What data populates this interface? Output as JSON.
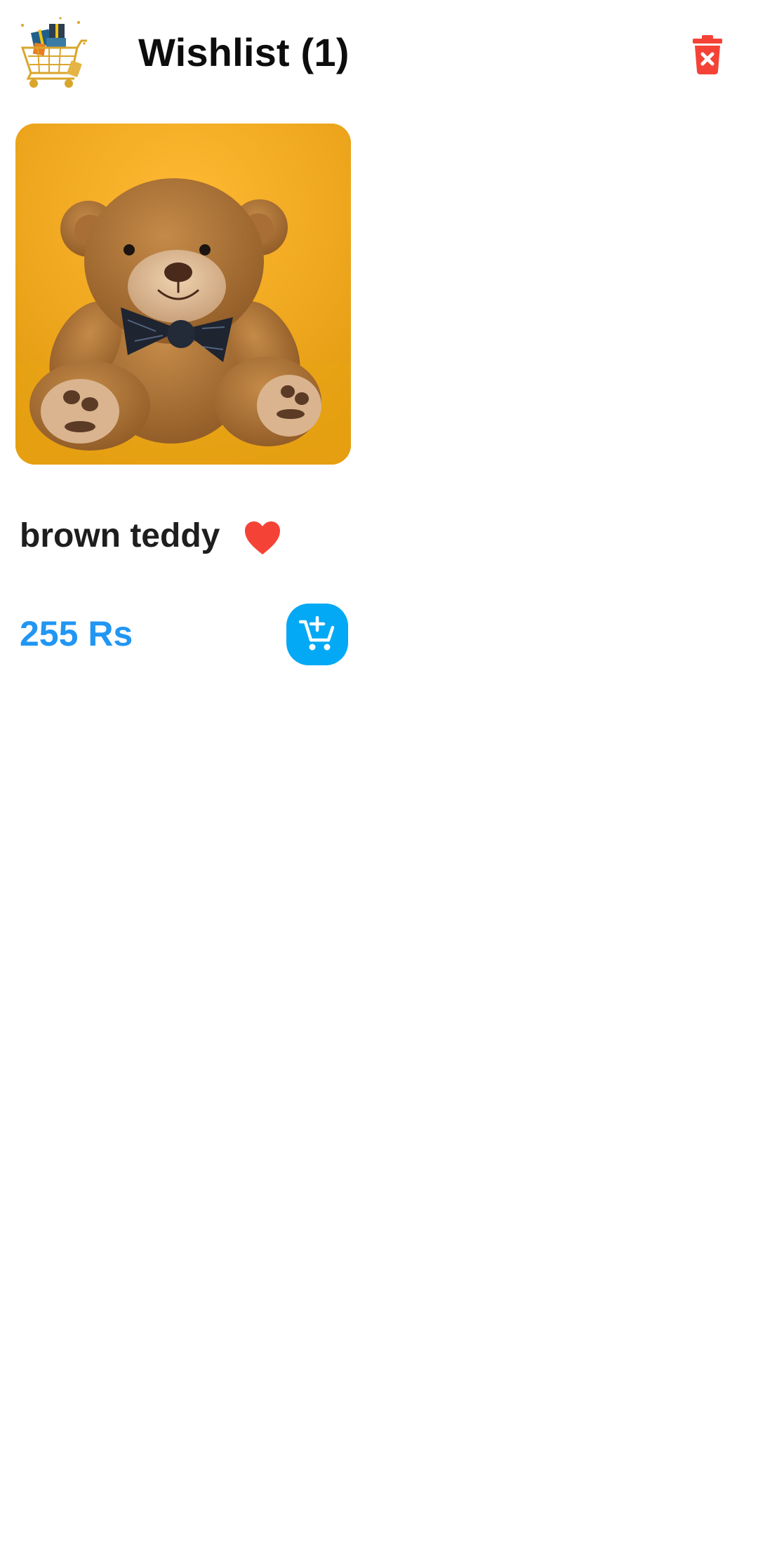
{
  "header": {
    "title": "Wishlist (1)",
    "logo_icon": "shopping-cart-gifts-icon",
    "delete_icon": "trash-x-icon",
    "delete_color": "#f44336"
  },
  "wishlist": {
    "items": [
      {
        "name": "brown teddy",
        "price": "255 Rs",
        "image": "teddy-bear-photo",
        "favorite": true,
        "favorite_icon": "heart-icon",
        "favorite_color": "#f44336",
        "cart_icon": "add-to-cart-icon",
        "cart_button_color": "#03a9f4",
        "price_color": "#2196f3"
      }
    ]
  }
}
